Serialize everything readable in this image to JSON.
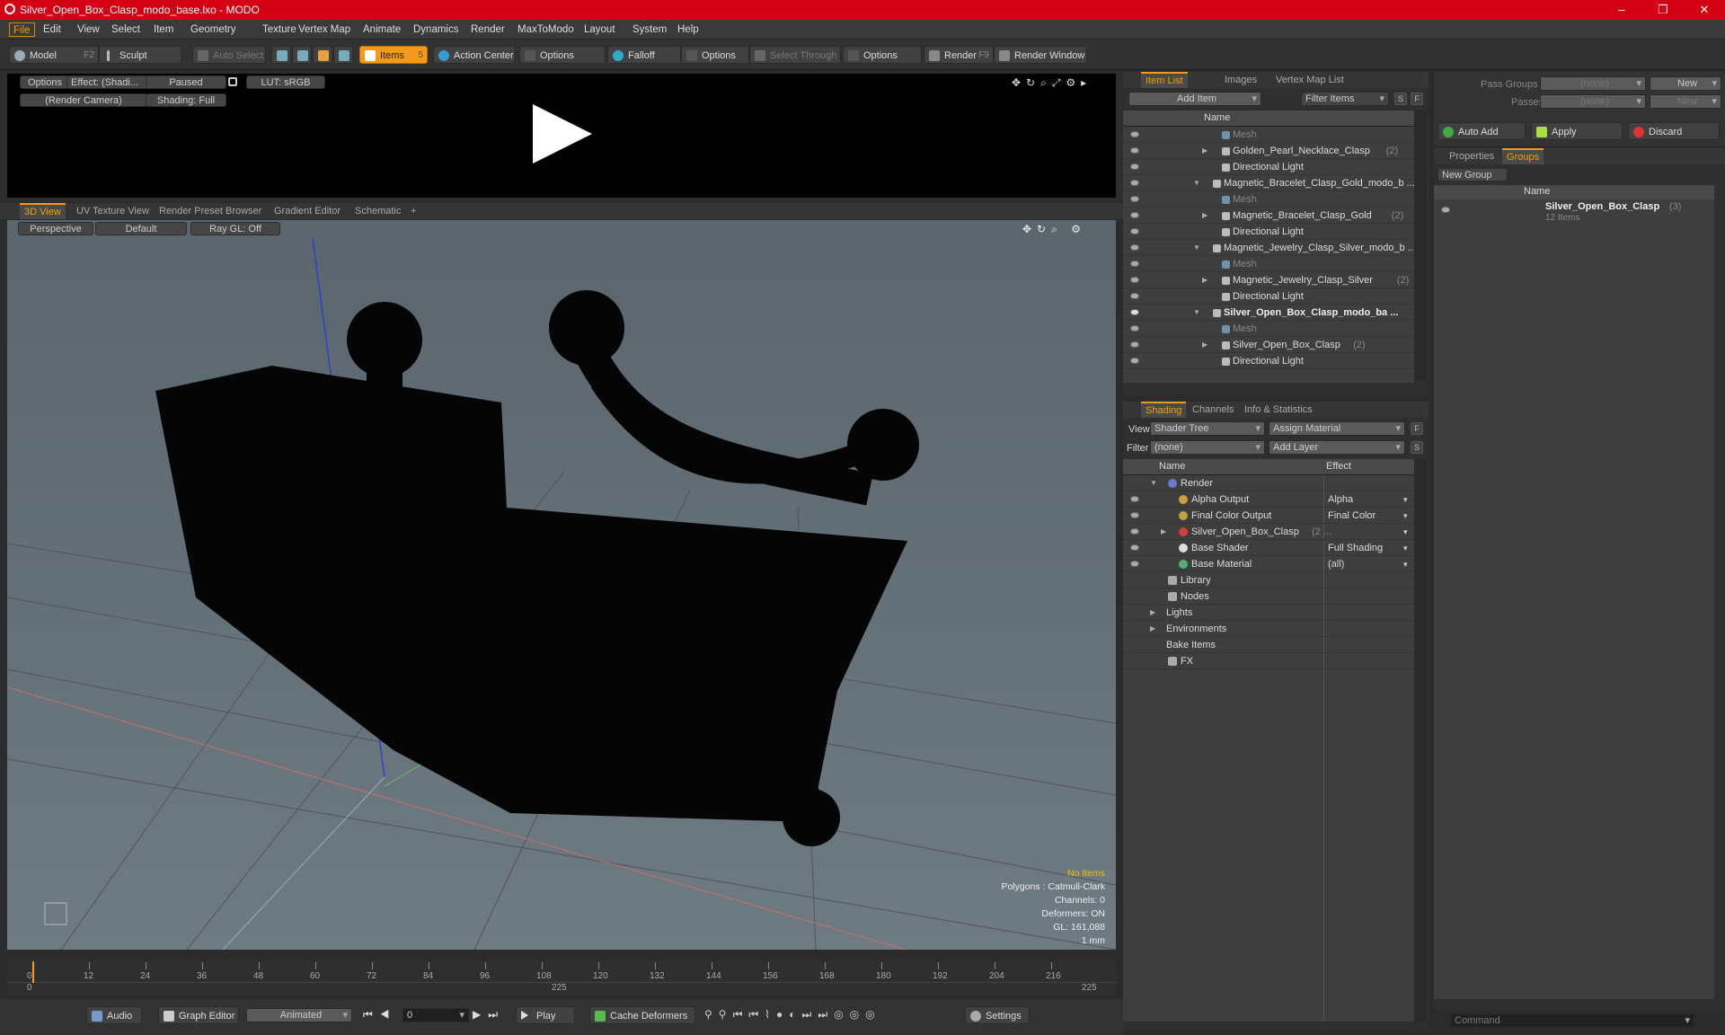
{
  "window": {
    "title": "Silver_Open_Box_Clasp_modo_base.lxo - MODO",
    "controls": [
      "–",
      "❐",
      "✕"
    ]
  },
  "menu": [
    "File",
    "Edit",
    "View",
    "Select",
    "Item",
    "Geometry",
    "Texture",
    "Vertex Map",
    "Animate",
    "Dynamics",
    "Render",
    "MaxToModo",
    "Layout",
    "System",
    "Help"
  ],
  "toolbar": {
    "model": "Model",
    "model_key": "F2",
    "sculpt": "Sculpt",
    "auto_select": "Auto Select",
    "items": "Items",
    "items_key": "5",
    "action_center": "Action Center",
    "options1": "Options",
    "falloff": "Falloff",
    "options2": "Options",
    "select_through": "Select Through",
    "options3": "Options",
    "render": "Render",
    "render_key": "F9",
    "render_window": "Render Window"
  },
  "preview": {
    "options": "Options",
    "effect": "Effect: (Shadi...",
    "paused": "Paused",
    "lut": "LUT: sRGB",
    "camera": "(Render Camera)",
    "shading": "Shading: Full"
  },
  "viewtabs": {
    "tabs": [
      "3D View",
      "UV Texture View",
      "Render Preset Browser",
      "Gradient Editor",
      "Schematic"
    ],
    "plus": "+"
  },
  "viewport": {
    "perspective": "Perspective",
    "default": "Default",
    "raygl": "Ray GL: Off",
    "info": [
      "No Items",
      "Polygons : Catmull-Clark",
      "Channels: 0",
      "Deformers: ON",
      "GL: 161,088",
      "1 mm"
    ]
  },
  "timeline": {
    "ticks": [
      "0",
      "12",
      "24",
      "36",
      "48",
      "60",
      "72",
      "84",
      "96",
      "108",
      "120",
      "132",
      "144",
      "156",
      "168",
      "180",
      "192",
      "204",
      "216"
    ],
    "start": "0",
    "mid": "225",
    "end": "225"
  },
  "bottombar": {
    "audio": "Audio",
    "graph_editor": "Graph Editor",
    "animated": "Animated",
    "frame": "0",
    "play": "Play",
    "cache": "Cache Deformers",
    "settings": "Settings"
  },
  "itemlist": {
    "tabs": [
      "Item List",
      "Images",
      "Vertex Map List"
    ],
    "add_item": "Add Item",
    "filter": "Filter Items",
    "s": "S",
    "f": "F",
    "col_name": "Name",
    "rows": [
      {
        "label": "Mesh",
        "cnt": "",
        "indent": 1,
        "arrow": "",
        "kind": "mesh"
      },
      {
        "label": "Golden_Pearl_Necklace_Clasp",
        "cnt": "(2)",
        "indent": 1,
        "arrow": "▶",
        "kind": "item"
      },
      {
        "label": "Directional Light",
        "cnt": "",
        "indent": 1,
        "arrow": "",
        "kind": "item"
      },
      {
        "label": "Magnetic_Bracelet_Clasp_Gold_modo_b ...",
        "cnt": "",
        "indent": 0,
        "arrow": "▼",
        "kind": "scene"
      },
      {
        "label": "Mesh",
        "cnt": "",
        "indent": 1,
        "arrow": "",
        "kind": "mesh"
      },
      {
        "label": "Magnetic_Bracelet_Clasp_Gold",
        "cnt": "(2)",
        "indent": 1,
        "arrow": "▶",
        "kind": "item"
      },
      {
        "label": "Directional Light",
        "cnt": "",
        "indent": 1,
        "arrow": "",
        "kind": "item"
      },
      {
        "label": "Magnetic_Jewelry_Clasp_Silver_modo_b ...",
        "cnt": "",
        "indent": 0,
        "arrow": "▼",
        "kind": "scene"
      },
      {
        "label": "Mesh",
        "cnt": "",
        "indent": 1,
        "arrow": "",
        "kind": "mesh"
      },
      {
        "label": "Magnetic_Jewelry_Clasp_Silver",
        "cnt": "(2)",
        "indent": 1,
        "arrow": "▶",
        "kind": "item"
      },
      {
        "label": "Directional Light",
        "cnt": "",
        "indent": 1,
        "arrow": "",
        "kind": "item"
      },
      {
        "label": "Silver_Open_Box_Clasp_modo_ba ...",
        "cnt": "",
        "indent": 0,
        "arrow": "▼",
        "kind": "bold"
      },
      {
        "label": "Mesh",
        "cnt": "",
        "indent": 1,
        "arrow": "",
        "kind": "mesh"
      },
      {
        "label": "Silver_Open_Box_Clasp",
        "cnt": "(2)",
        "indent": 1,
        "arrow": "▶",
        "kind": "item"
      },
      {
        "label": "Directional Light",
        "cnt": "",
        "indent": 1,
        "arrow": "",
        "kind": "item"
      }
    ]
  },
  "shading": {
    "tabs": [
      "Shading",
      "Channels",
      "Info & Statistics"
    ],
    "view_label": "View",
    "view_value": "Shader Tree",
    "assign": "Assign Material",
    "filter_label": "Filter",
    "filter_value": "(none)",
    "add_layer": "Add Layer",
    "f": "F",
    "s": "S",
    "col_name": "Name",
    "col_effect": "Effect",
    "rows": [
      {
        "label": "Render",
        "effect": "",
        "indent": 0,
        "arrow": "▼",
        "eye": false,
        "color": "#6a78d0"
      },
      {
        "label": "Alpha Output",
        "effect": "Alpha",
        "indent": 1,
        "arrow": "",
        "eye": true,
        "color": "#c8a040"
      },
      {
        "label": "Final Color Output",
        "effect": "Final Color",
        "indent": 1,
        "arrow": "",
        "eye": true,
        "color": "#c8a040"
      },
      {
        "label": "Silver_Open_Box_Clasp",
        "cnt": "(2 ...",
        "effect": "",
        "indent": 1,
        "arrow": "▶",
        "eye": true,
        "color": "#d04040"
      },
      {
        "label": "Base Shader",
        "effect": "Full Shading",
        "indent": 1,
        "arrow": "",
        "eye": true,
        "color": "#dddddd"
      },
      {
        "label": "Base Material",
        "effect": "(all)",
        "indent": 1,
        "arrow": "",
        "eye": true,
        "color": "#50b070"
      },
      {
        "label": "Library",
        "effect": "",
        "indent": 0,
        "arrow": "",
        "eye": false,
        "color": "#aaaaaa"
      },
      {
        "label": "Nodes",
        "effect": "",
        "indent": 0,
        "arrow": "",
        "eye": false,
        "color": "#aaaaaa"
      },
      {
        "label": "Lights",
        "effect": "",
        "indent": -1,
        "arrow": "▶",
        "eye": false,
        "color": ""
      },
      {
        "label": "Environments",
        "effect": "",
        "indent": -1,
        "arrow": "▶",
        "eye": false,
        "color": ""
      },
      {
        "label": "Bake Items",
        "effect": "",
        "indent": -1,
        "arrow": "",
        "eye": false,
        "color": ""
      },
      {
        "label": "FX",
        "effect": "",
        "indent": 0,
        "arrow": "",
        "eye": false,
        "color": "#aaaaaa"
      }
    ]
  },
  "passes": {
    "pass_groups": "Pass Groups",
    "passes": "Passes",
    "none": "(none)",
    "new": "New",
    "auto_add": "Auto Add",
    "apply": "Apply",
    "discard": "Discard"
  },
  "groups": {
    "tabs": [
      "Properties",
      "Groups"
    ],
    "new_group": "New Group",
    "col_name": "Name",
    "item": "Silver_Open_Box_Clasp",
    "item_cnt": "(3)",
    "item_sub": "12 Items"
  },
  "command": {
    "placeholder": "Command"
  }
}
